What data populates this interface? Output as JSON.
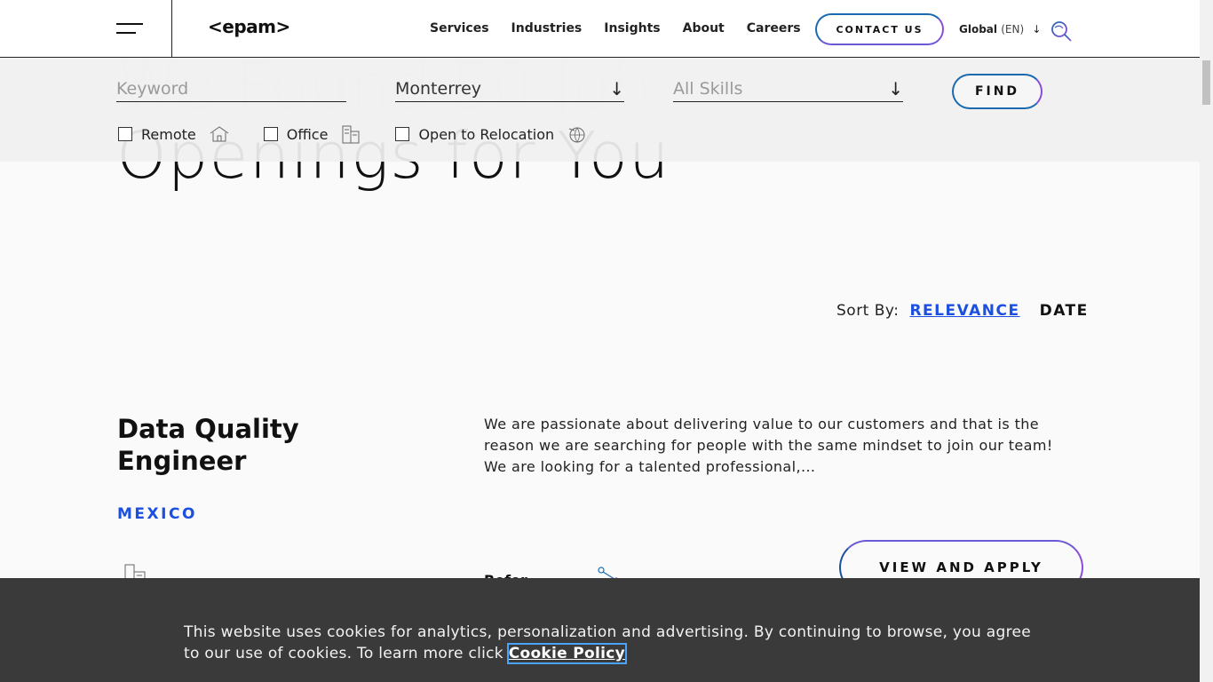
{
  "header": {
    "logo": "<epam>",
    "nav": [
      "Services",
      "Industries",
      "Insights",
      "About",
      "Careers"
    ],
    "contact_label": "CONTACT US",
    "global_label": "Global",
    "lang_label": "(EN)"
  },
  "filter": {
    "keyword_placeholder": "Keyword",
    "location_value": "Monterrey",
    "skills_placeholder": "All Skills",
    "find_label": "FIND",
    "checkboxes": {
      "remote": "Remote",
      "office": "Office",
      "relocation": "Open to Relocation"
    }
  },
  "hero": {
    "title_line2": "Openings for You"
  },
  "sort": {
    "label": "Sort By:",
    "relevance": "RELEVANCE",
    "date": "DATE"
  },
  "job": {
    "title": "Data Quality Engineer",
    "country": "MEXICO",
    "description": "We are passionate about delivering value to our customers and that is the reason we are searching for people with the same mindset to join our team! We are looking for a talented professional,...",
    "apply_label": "VIEW AND APPLY",
    "refer_label": "Refer"
  },
  "cookie": {
    "text": "This website uses cookies for analytics, personalization and advertising. By continuing to browse, you agree to our use of cookies. To learn more click",
    "link_label": "Cookie Policy"
  },
  "colors": {
    "accent_blue": "#1b4fe0",
    "gradient_purple": "#8a4fd8",
    "cookie_bg": "#3a3a3a"
  }
}
